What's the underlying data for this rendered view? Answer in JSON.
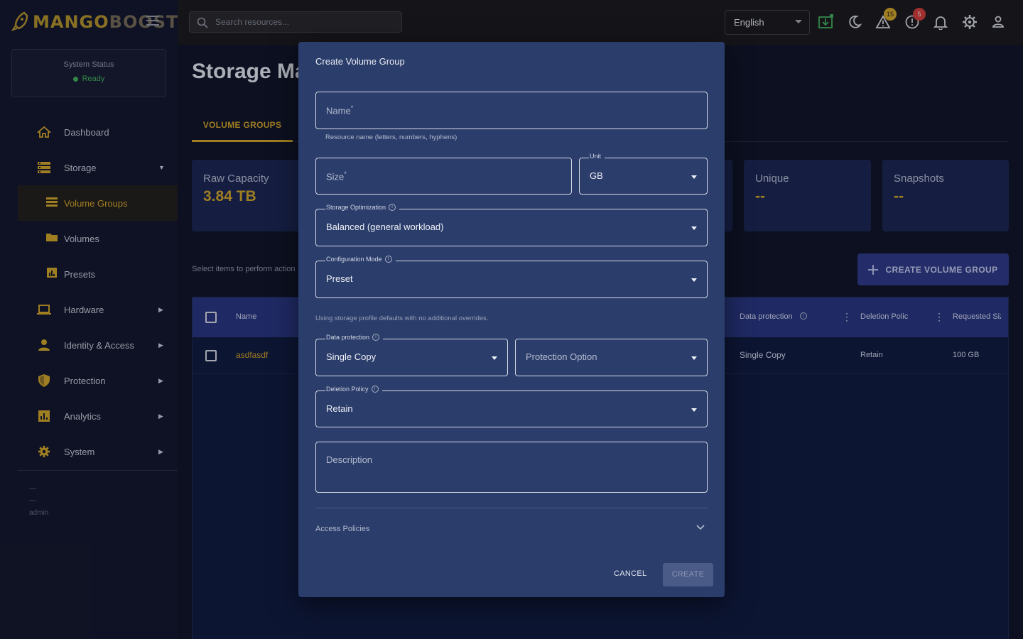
{
  "app": {
    "logo_part1": "MANGO",
    "logo_part2": "BOOST"
  },
  "sidebar": {
    "status_title": "System Status",
    "status_value": "Ready",
    "items": [
      {
        "label": "Dashboard",
        "icon": "home-icon"
      },
      {
        "label": "Storage",
        "icon": "storage-icon",
        "expanded": true
      },
      {
        "label": "Volume Groups",
        "icon": "list-icon",
        "active": true
      },
      {
        "label": "Volumes",
        "icon": "folder-icon"
      },
      {
        "label": "Presets",
        "icon": "chart-icon"
      },
      {
        "label": "Hardware",
        "icon": "laptop-icon"
      },
      {
        "label": "Identity & Access",
        "icon": "person-icon"
      },
      {
        "label": "Protection",
        "icon": "shield-icon"
      },
      {
        "label": "Analytics",
        "icon": "analytics-icon"
      },
      {
        "label": "System",
        "icon": "gear-icon"
      }
    ],
    "footer_lines": [
      "—",
      "—"
    ],
    "footer_user": "admin"
  },
  "header": {
    "search_placeholder": "Search resources...",
    "language": "English",
    "warning_count": "15",
    "error_count": "5"
  },
  "page": {
    "title": "Storage Ma",
    "tab_active": "VOLUME GROUPS",
    "cards": [
      {
        "label": "Raw Capacity",
        "value": "3.84 TB"
      },
      {
        "label": "Unique",
        "value": "--"
      },
      {
        "label": "Snapshots",
        "value": "--"
      }
    ],
    "select_hint": "Select items to perform action",
    "create_button": "CREATE VOLUME GROUP",
    "table": {
      "headers": [
        "Name",
        "Data protection",
        "Deletion Polic",
        "Requested Siz"
      ],
      "rows": [
        {
          "name": "asdfasdf",
          "data_protection": "Single Copy",
          "deletion_policy": "Retain",
          "requested_size": "100 GB"
        }
      ]
    }
  },
  "dialog": {
    "title": "Create Volume Group",
    "name_placeholder": "Name",
    "name_helper": "Resource name (letters, numbers, hyphens)",
    "size_placeholder": "Size",
    "required_mark": "*",
    "unit_label": "Unit",
    "unit_value": "GB",
    "opt_label": "Storage Optimization",
    "opt_value": "Balanced (general workload)",
    "config_label": "Configuration Mode",
    "config_value": "Preset",
    "config_note": "Using storage profile defaults with no additional overrides.",
    "dp_label": "Data protection",
    "dp_value": "Single Copy",
    "protection_option_placeholder": "Protection Option",
    "deletion_label": "Deletion Policy",
    "deletion_value": "Retain",
    "description_placeholder": "Description",
    "access_policies": "Access Policies",
    "cancel": "CANCEL",
    "create": "CREATE"
  },
  "colors": {
    "accent": "#c49a2a",
    "primary_button": "#2d3780",
    "dialog_bg": "#2b3d6b"
  }
}
